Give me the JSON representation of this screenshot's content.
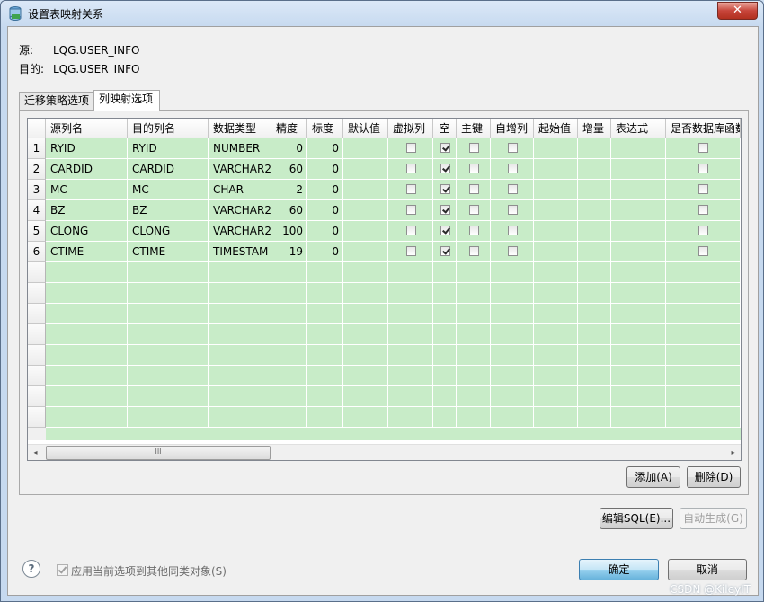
{
  "window": {
    "title": "设置表映射关系",
    "close_label": "✕"
  },
  "source": {
    "label": "源:",
    "value": "LQG.USER_INFO"
  },
  "target": {
    "label": "目的:",
    "value": "LQG.USER_INFO"
  },
  "tabs": [
    {
      "label": "迁移策略选项",
      "active": false
    },
    {
      "label": "列映射选项",
      "active": true
    }
  ],
  "table": {
    "columns": [
      "源列名",
      "目的列名",
      "数据类型",
      "精度",
      "标度",
      "默认值",
      "虚拟列",
      "空",
      "主键",
      "自增列",
      "起始值",
      "增量",
      "表达式",
      "是否数据库函数"
    ],
    "rows": [
      {
        "num": "1",
        "src": "RYID",
        "dst": "RYID",
        "type": "NUMBER",
        "precision": "0",
        "scale": "0",
        "virtual": false,
        "nullable": true,
        "pk": false,
        "autoinc": false,
        "dbfunc": false
      },
      {
        "num": "2",
        "src": "CARDID",
        "dst": "CARDID",
        "type": "VARCHAR2",
        "precision": "60",
        "scale": "0",
        "virtual": false,
        "nullable": true,
        "pk": false,
        "autoinc": false,
        "dbfunc": false
      },
      {
        "num": "3",
        "src": "MC",
        "dst": "MC",
        "type": "CHAR",
        "precision": "2",
        "scale": "0",
        "virtual": false,
        "nullable": true,
        "pk": false,
        "autoinc": false,
        "dbfunc": false
      },
      {
        "num": "4",
        "src": "BZ",
        "dst": "BZ",
        "type": "VARCHAR2",
        "precision": "60",
        "scale": "0",
        "virtual": false,
        "nullable": true,
        "pk": false,
        "autoinc": false,
        "dbfunc": false
      },
      {
        "num": "5",
        "src": "CLONG",
        "dst": "CLONG",
        "type": "VARCHAR2",
        "precision": "100",
        "scale": "0",
        "virtual": false,
        "nullable": true,
        "pk": false,
        "autoinc": false,
        "dbfunc": false
      },
      {
        "num": "6",
        "src": "CTIME",
        "dst": "CTIME",
        "type": "TIMESTAM",
        "precision": "19",
        "scale": "0",
        "virtual": false,
        "nullable": true,
        "pk": false,
        "autoinc": false,
        "dbfunc": false
      }
    ],
    "empty_rows": 8
  },
  "scrollbar": {
    "left_arrow": "◂",
    "right_arrow": "▸",
    "grip": "III"
  },
  "buttons": {
    "add": "添加(A)",
    "delete": "删除(D)",
    "edit_sql": "编辑SQL(E)...",
    "auto_gen": "自动生成(G)",
    "ok": "确定",
    "cancel": "取消"
  },
  "footer": {
    "help": "?",
    "apply_label": "应用当前选项到其他同类对象(S)",
    "apply_checked": true
  },
  "watermark": "CSDN @KileyIT"
}
